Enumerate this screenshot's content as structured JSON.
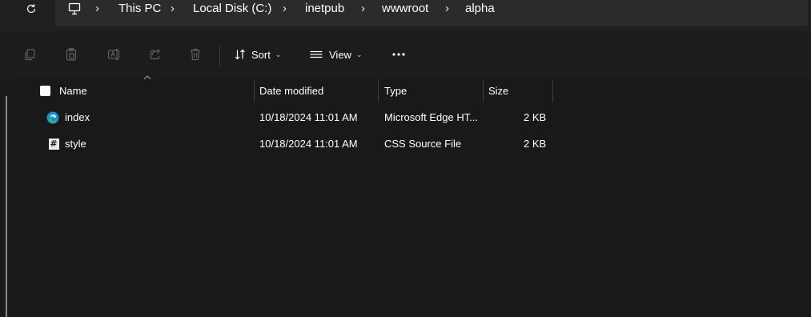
{
  "breadcrumb": {
    "items": [
      "This PC",
      "Local Disk (C:)",
      "inetpub",
      "wwwroot",
      "alpha"
    ],
    "separator": "›"
  },
  "toolbar": {
    "sort_label": "Sort",
    "view_label": "View"
  },
  "columns": {
    "name": "Name",
    "date_modified": "Date modified",
    "type": "Type",
    "size": "Size"
  },
  "files": [
    {
      "name": "index",
      "date": "10/18/2024 11:01 AM",
      "type": "Microsoft Edge HT...",
      "size": "2 KB",
      "icon": "edge-html-icon"
    },
    {
      "name": "style",
      "date": "10/18/2024 11:01 AM",
      "type": "CSS Source File",
      "size": "2 KB",
      "icon": "css-file-icon"
    }
  ],
  "colors": {
    "background": "#191919",
    "address_bar": "#2b2b2b",
    "edge_blue": "#1a8fd4",
    "edge_green": "#36b36a"
  }
}
